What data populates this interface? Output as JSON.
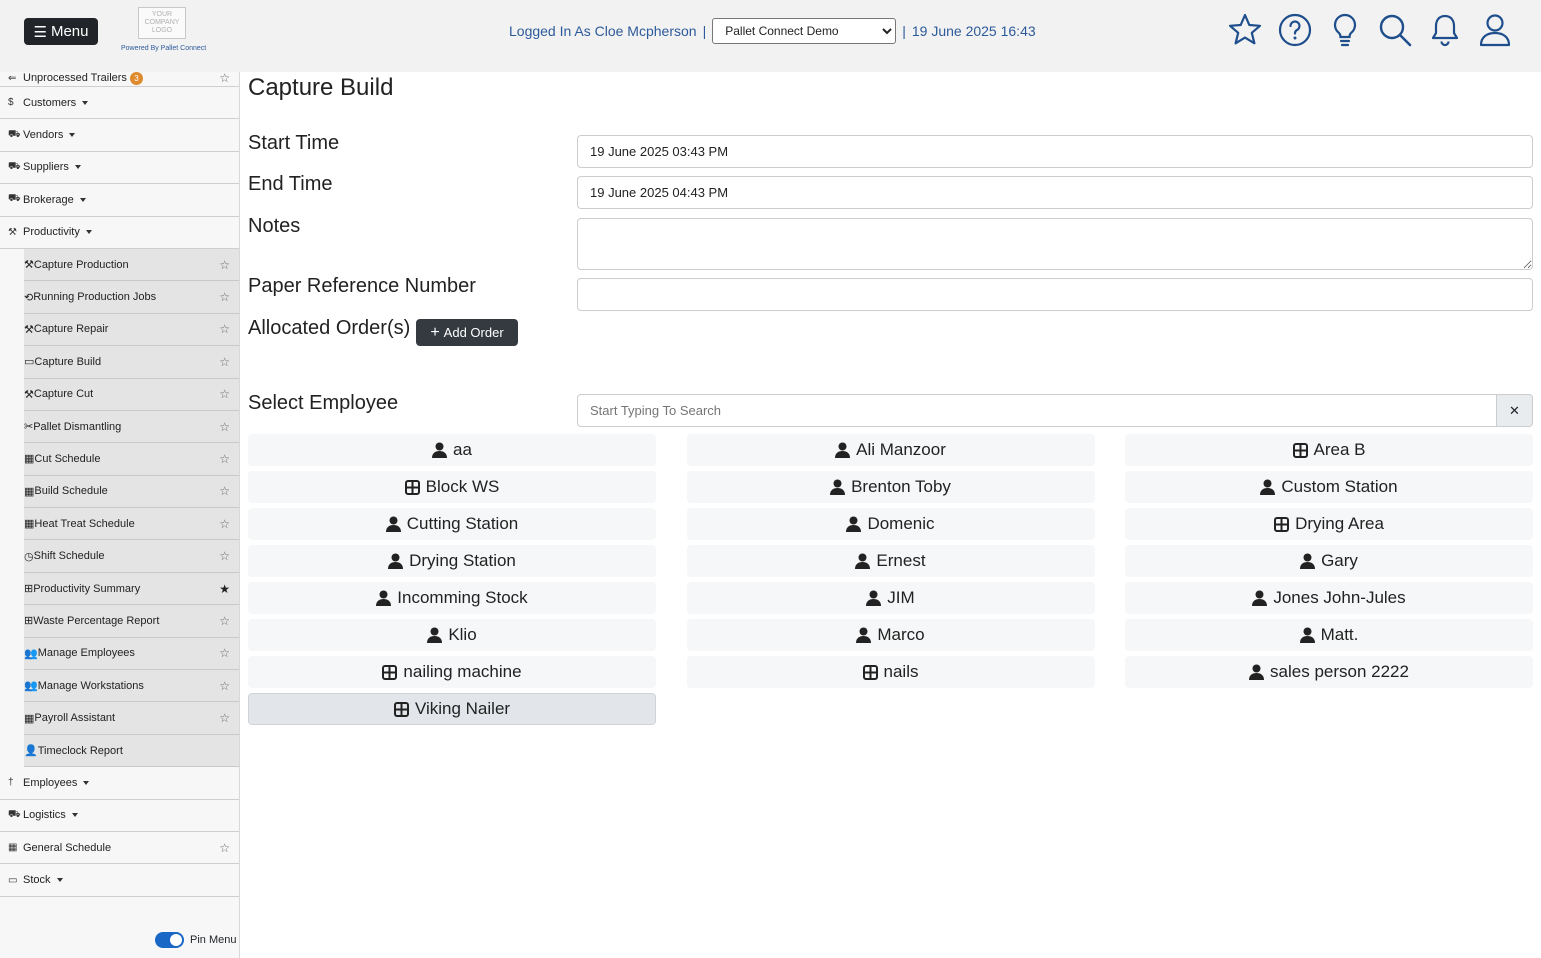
{
  "header": {
    "menu_label": "Menu",
    "logo_text": "YOUR COMPANY LOGO",
    "powered_by": "Powered By Pallet Connect",
    "logged_in_text": "Logged In As Cloe Mcpherson",
    "separator": "|",
    "company_selected": "Pallet Connect Demo",
    "datetime": "19 June 2025 16:43",
    "icons": [
      "star-icon",
      "help-icon",
      "lightbulb-icon",
      "search-icon",
      "bell-icon",
      "user-icon"
    ]
  },
  "sidebar": {
    "top_item": {
      "label": "Unprocessed Trailers",
      "badge": "3"
    },
    "items_before": [
      {
        "icon": "$",
        "label": "Customers"
      },
      {
        "icon": "⛟",
        "label": "Vendors"
      },
      {
        "icon": "⛟",
        "label": "Suppliers"
      },
      {
        "icon": "⛟",
        "label": "Brokerage"
      },
      {
        "icon": "⚒",
        "label": "Productivity"
      }
    ],
    "productivity_sub": [
      {
        "icon": "⚒",
        "label": "Capture Production",
        "starred": false
      },
      {
        "icon": "⟲",
        "label": "Running Production Jobs",
        "starred": false
      },
      {
        "icon": "⚒",
        "label": "Capture Repair",
        "starred": false
      },
      {
        "icon": "▭",
        "label": "Capture Build",
        "starred": false
      },
      {
        "icon": "⚒",
        "label": "Capture Cut",
        "starred": false
      },
      {
        "icon": "✂",
        "label": "Pallet Dismantling",
        "starred": false
      },
      {
        "icon": "▦",
        "label": "Cut Schedule",
        "starred": false
      },
      {
        "icon": "▦",
        "label": "Build Schedule",
        "starred": false
      },
      {
        "icon": "▦",
        "label": "Heat Treat Schedule",
        "starred": false
      },
      {
        "icon": "◷",
        "label": "Shift Schedule",
        "starred": false
      },
      {
        "icon": "⊞",
        "label": "Productivity Summary",
        "starred": true
      },
      {
        "icon": "⊞",
        "label": "Waste Percentage Report",
        "starred": false
      },
      {
        "icon": "👥",
        "label": "Manage Employees",
        "starred": false
      },
      {
        "icon": "👥",
        "label": "Manage Workstations",
        "starred": false
      },
      {
        "icon": "▦",
        "label": "Payroll Assistant",
        "starred": false
      },
      {
        "icon": "👤",
        "label": "Timeclock Report",
        "starred": null
      }
    ],
    "items_after": [
      {
        "icon": "†",
        "label": "Employees",
        "caret": true,
        "starred": null
      },
      {
        "icon": "⛟",
        "label": "Logistics",
        "caret": true,
        "starred": null
      },
      {
        "icon": "▦",
        "label": "General Schedule",
        "caret": false,
        "starred": false
      },
      {
        "icon": "▭",
        "label": "Stock",
        "caret": true,
        "starred": null
      }
    ],
    "pin_label": "Pin Menu"
  },
  "main": {
    "title": "Capture Build",
    "start_time_label": "Start Time",
    "start_time_value": "19 June 2025 03:43 PM",
    "end_time_label": "End Time",
    "end_time_value": "19 June 2025 04:43 PM",
    "notes_label": "Notes",
    "paper_ref_label": "Paper Reference Number",
    "allocated_label": "Allocated Order(s)",
    "add_order_label": "Add Order",
    "select_employee_label": "Select Employee",
    "search_placeholder": "Start Typing To Search",
    "employees": [
      {
        "name": "aa",
        "type": "person"
      },
      {
        "name": "Ali Manzoor",
        "type": "person"
      },
      {
        "name": "Area B",
        "type": "station"
      },
      {
        "name": "Block WS",
        "type": "station"
      },
      {
        "name": "Brenton Toby",
        "type": "person"
      },
      {
        "name": "Custom Station",
        "type": "person"
      },
      {
        "name": "Cutting Station",
        "type": "person"
      },
      {
        "name": "Domenic",
        "type": "person"
      },
      {
        "name": "Drying Area",
        "type": "station"
      },
      {
        "name": "Drying Station",
        "type": "person"
      },
      {
        "name": "Ernest",
        "type": "person"
      },
      {
        "name": "Gary",
        "type": "person"
      },
      {
        "name": "Incomming Stock",
        "type": "person"
      },
      {
        "name": "JIM",
        "type": "person"
      },
      {
        "name": "Jones John-Jules",
        "type": "person"
      },
      {
        "name": "Klio",
        "type": "person"
      },
      {
        "name": "Marco",
        "type": "person"
      },
      {
        "name": "Matt.",
        "type": "person"
      },
      {
        "name": "nailing machine",
        "type": "station"
      },
      {
        "name": "nails",
        "type": "station"
      },
      {
        "name": "sales person 2222",
        "type": "person"
      },
      {
        "name": "Viking Nailer",
        "type": "station",
        "selected": true
      }
    ]
  }
}
